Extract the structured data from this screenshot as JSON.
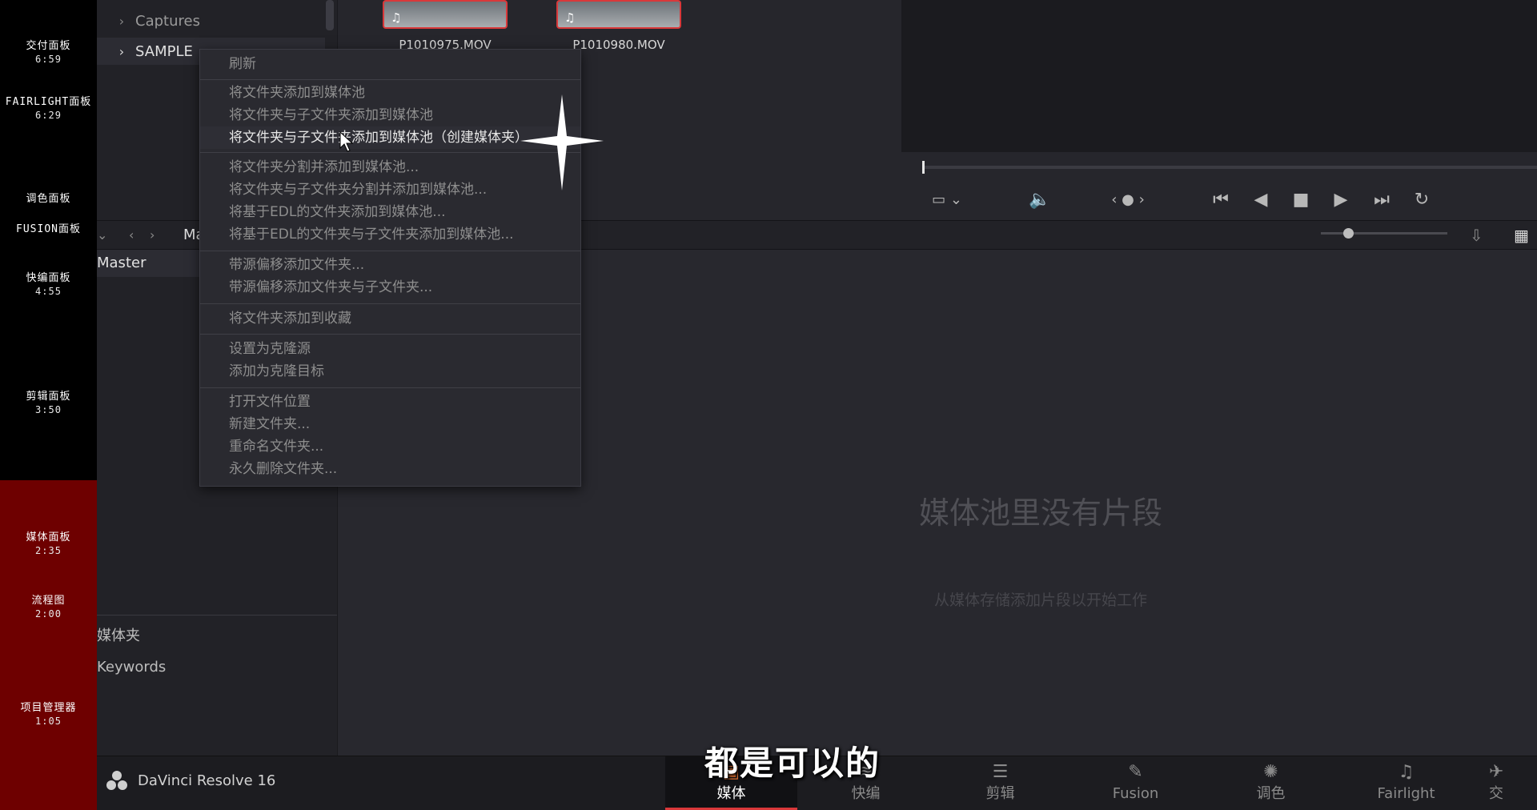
{
  "chapters": [
    {
      "title": "交付面板",
      "time": "6:59"
    },
    {
      "title": "FAIRLIGHT面板",
      "time": "6:29"
    },
    {
      "title": "调色面板",
      "time": ""
    },
    {
      "title": "FUSION面板",
      "time": ""
    },
    {
      "title": "快编面板",
      "time": "4:55"
    },
    {
      "title": "剪辑面板",
      "time": "3:50"
    },
    {
      "title": "媒体面板",
      "time": "2:35"
    },
    {
      "title": "流程图",
      "time": "2:00"
    },
    {
      "title": "项目管理器",
      "time": "1:05"
    }
  ],
  "media_storage": {
    "folders": [
      {
        "label": "Captures"
      },
      {
        "label": "SAMPLE"
      }
    ],
    "clips": [
      {
        "name": "P1010975.MOV"
      },
      {
        "name": "P1010980.MOV"
      }
    ]
  },
  "toolbar": {
    "bin_label": "Ma"
  },
  "media_pool": {
    "master": "Master",
    "smart_bins": [
      "媒体夹",
      "Keywords"
    ],
    "empty_title": "媒体池里没有片段",
    "empty_subtitle": "从媒体存储添加片段以开始工作"
  },
  "context_menu": {
    "groups": [
      [
        "刷新"
      ],
      [
        "将文件夹添加到媒体池",
        "将文件夹与子文件夹添加到媒体池",
        "将文件夹与子文件夹添加到媒体池（创建媒体夹）"
      ],
      [
        "将文件夹分割并添加到媒体池...",
        "将文件夹与子文件夹分割并添加到媒体池...",
        "将基于EDL的文件夹添加到媒体池...",
        "将基于EDL的文件夹与子文件夹添加到媒体池..."
      ],
      [
        "带源偏移添加文件夹...",
        "带源偏移添加文件夹与子文件夹..."
      ],
      [
        "将文件夹添加到收藏"
      ],
      [
        "设置为克隆源",
        "添加为克隆目标"
      ],
      [
        "打开文件位置",
        "新建文件夹...",
        "重命名文件夹...",
        "永久删除文件夹..."
      ]
    ],
    "highlighted": "将文件夹与子文件夹添加到媒体池（创建媒体夹）"
  },
  "app": {
    "name": "DaVinci Resolve 16"
  },
  "page_tabs": [
    {
      "label": "媒体",
      "icon": "media-page-icon",
      "active": true
    },
    {
      "label": "快编",
      "icon": "cut-page-icon",
      "active": false
    },
    {
      "label": "剪辑",
      "icon": "edit-page-icon",
      "active": false
    },
    {
      "label": "Fusion",
      "icon": "fusion-page-icon",
      "active": false
    },
    {
      "label": "调色",
      "icon": "color-page-icon",
      "active": false
    },
    {
      "label": "Fairlight",
      "icon": "fairlight-page-icon",
      "active": false
    },
    {
      "label": "交",
      "icon": "deliver-page-icon",
      "active": false
    }
  ],
  "subtitle": "都是可以的",
  "colors": {
    "accent_red": "#d9383a",
    "chapter_red": "#6e0000"
  }
}
